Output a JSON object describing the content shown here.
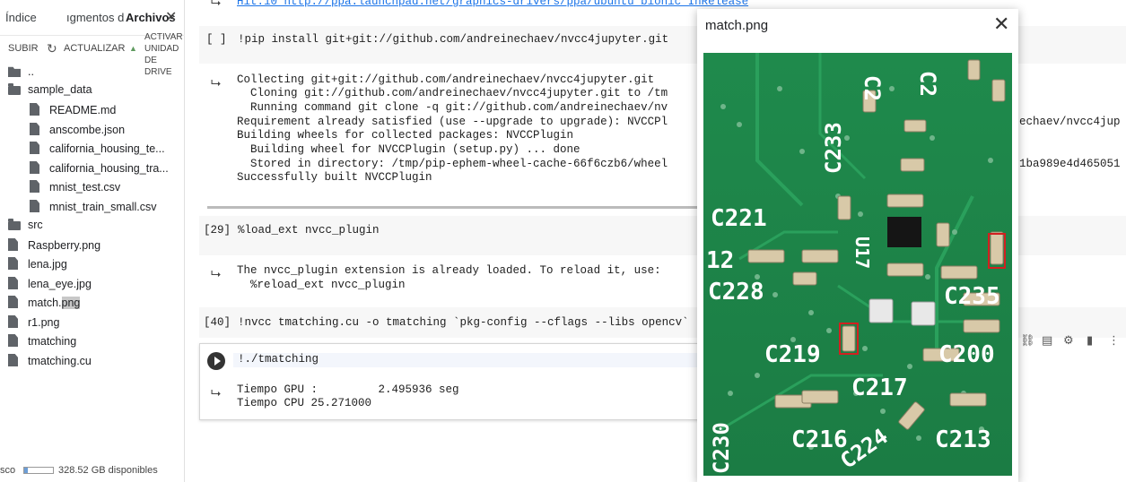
{
  "sidebar": {
    "tabs": {
      "indice": "Índice",
      "fragmentos": "ıgmentos de cód",
      "archivos": "Archivos"
    },
    "toolbar": {
      "subir": "SUBIR",
      "actualizar": "ACTUALIZAR",
      "activar": "ACTIVAR UNIDAD DE DRIVE"
    },
    "tree": [
      {
        "name": "..",
        "type": "up"
      },
      {
        "name": "sample_data",
        "type": "folder"
      },
      {
        "name": "README.md",
        "type": "file"
      },
      {
        "name": "anscombe.json",
        "type": "file"
      },
      {
        "name": "california_housing_te...",
        "type": "file"
      },
      {
        "name": "california_housing_tra...",
        "type": "file"
      },
      {
        "name": "mnist_test.csv",
        "type": "file"
      },
      {
        "name": "mnist_train_small.csv",
        "type": "file"
      },
      {
        "name": "src",
        "type": "folder"
      },
      {
        "name": "Raspberry.png",
        "type": "file"
      },
      {
        "name": "lena.jpg",
        "type": "file"
      },
      {
        "name": "lena_eye.jpg",
        "type": "file"
      },
      {
        "name": "match.png",
        "type": "file"
      },
      {
        "name": "r1.png",
        "type": "file"
      },
      {
        "name": "tmatching",
        "type": "file"
      },
      {
        "name": "tmatching.cu",
        "type": "file"
      }
    ],
    "match_base": "match.",
    "match_ext": "png",
    "disk": {
      "label": "sco",
      "free": "328.52 GB disponibles",
      "used_fraction": 0.12
    }
  },
  "notebook": {
    "top_output": "Hit:10 http://ppa.launchpad.net/graphics-drivers/ppa/ubuntu bionic InRelease",
    "cell1": {
      "prompt": "[ ]",
      "code": "!pip install git+git://github.com/andreinechaev/nvcc4jupyter.git",
      "output": [
        "Collecting git+git://github.com/andreinechaev/nvcc4jupyter.git",
        "  Cloning git://github.com/andreinechaev/nvcc4jupyter.git to /tm",
        "  Running command git clone -q git://github.com/andreinechaev/nv",
        "Requirement already satisfied (use --upgrade to upgrade): NVCCPl",
        "Building wheels for collected packages: NVCCPlugin",
        "  Building wheel for NVCCPlugin (setup.py) ... done",
        "  Stored in directory: /tmp/pip-ephem-wheel-cache-66f6czb6/wheel",
        "Successfully built NVCCPlugin"
      ],
      "output_right_1": "echaev/nvcc4jup",
      "output_right_2": "1ba989e4d465051"
    },
    "cell2": {
      "prompt": "[29]",
      "code": "%load_ext nvcc_plugin",
      "output": [
        "The nvcc_plugin extension is already loaded. To reload it, use:",
        "  %reload_ext nvcc_plugin"
      ]
    },
    "cell3": {
      "prompt": "[40]",
      "code": "!nvcc tmatching.cu -o tmatching `pkg-config --cflags --libs opencv`"
    },
    "cell4": {
      "code": "!./tmatching",
      "output": [
        "Tiempo GPU :         2.495936 seg",
        "Tiempo CPU 25.271000"
      ]
    },
    "cell_toolbar_icons": [
      "link-icon",
      "comment-icon",
      "settings-icon",
      "delete-icon",
      "more-icon"
    ]
  },
  "viewer": {
    "title": "match.png",
    "image_labels": [
      "C2",
      "C2",
      "C233",
      "C221",
      "12",
      "U17",
      "C228",
      "C235",
      "C219",
      "C200",
      "C217",
      "C216",
      "C213",
      "C224",
      "C230"
    ]
  },
  "colors": {
    "pcb_green": "#1f8a4c",
    "match_box": "#d22020",
    "accent": "#1a73e8"
  }
}
